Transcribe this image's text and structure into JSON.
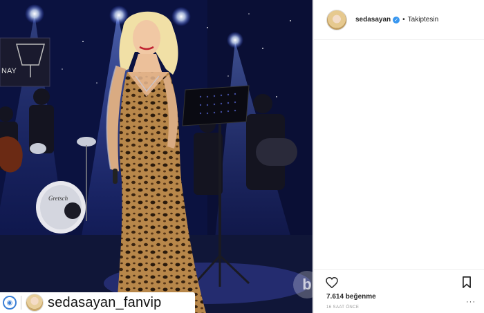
{
  "post": {
    "username": "sedasayan",
    "follow_status": "Takiptesin",
    "likes": "7.614 beğenme",
    "time": "16 SAAT ÖNCE",
    "overflow": "···"
  },
  "photo": {
    "watermark_user": "sedasayan_fanvip",
    "sign_text": "NAY",
    "drum_text": "Gretsch"
  },
  "icons": {
    "heart": "heart-icon",
    "bookmark": "bookmark-icon",
    "verified": "verified-badge-icon"
  },
  "colors": {
    "verified": "#3897f0",
    "stage_blue": "#1d2a7a",
    "divider": "#efefef"
  }
}
